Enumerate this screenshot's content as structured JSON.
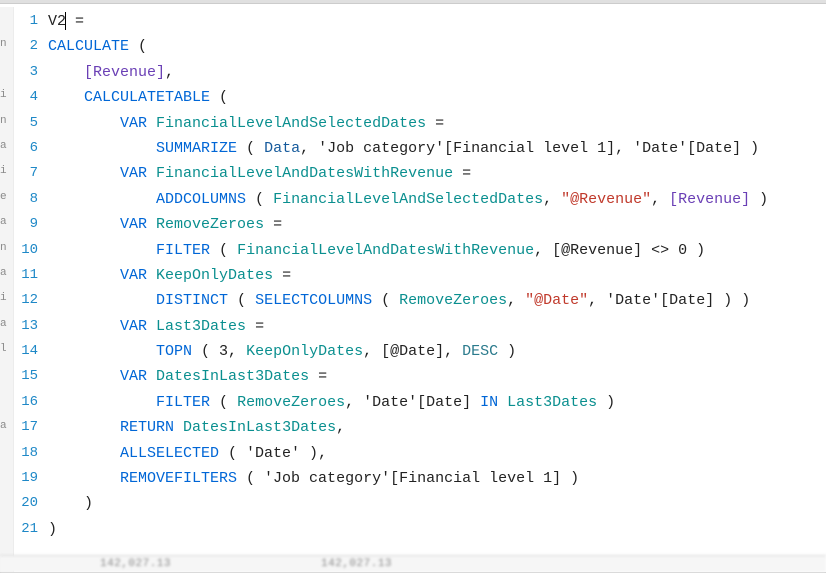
{
  "editor": {
    "leftEdgeChars": [
      "",
      "n",
      "",
      "i",
      "n",
      "a",
      "i",
      "e",
      "a",
      "n",
      "a",
      "i",
      "a",
      "l",
      "",
      "",
      "a",
      "",
      "",
      "",
      "",
      ""
    ],
    "lines": [
      {
        "num": 1,
        "indent": 0,
        "tokens": [
          {
            "t": "V2",
            "c": "op"
          },
          {
            "t": "|",
            "c": "cursor"
          },
          {
            "t": " =",
            "c": "op"
          }
        ]
      },
      {
        "num": 2,
        "indent": 0,
        "tokens": [
          {
            "t": "CALCULATE",
            "c": "kw"
          },
          {
            "t": " (",
            "c": "op"
          }
        ]
      },
      {
        "num": 3,
        "indent": 4,
        "tokens": [
          {
            "t": "[Revenue]",
            "c": "measure"
          },
          {
            "t": ",",
            "c": "op"
          }
        ]
      },
      {
        "num": 4,
        "indent": 4,
        "tokens": [
          {
            "t": "CALCULATETABLE",
            "c": "fn"
          },
          {
            "t": " (",
            "c": "op"
          }
        ]
      },
      {
        "num": 5,
        "indent": 8,
        "tokens": [
          {
            "t": "VAR",
            "c": "kw"
          },
          {
            "t": " ",
            "c": "op"
          },
          {
            "t": "FinancialLevelAndSelectedDates",
            "c": "varname"
          },
          {
            "t": " =",
            "c": "op"
          }
        ]
      },
      {
        "num": 6,
        "indent": 12,
        "tokens": [
          {
            "t": "SUMMARIZE",
            "c": "fn"
          },
          {
            "t": " ( ",
            "c": "op"
          },
          {
            "t": "Data",
            "c": "tbl"
          },
          {
            "t": ", 'Job category'[Financial level 1], 'Date'[Date] )",
            "c": "op"
          }
        ]
      },
      {
        "num": 7,
        "indent": 8,
        "tokens": [
          {
            "t": "VAR",
            "c": "kw"
          },
          {
            "t": " ",
            "c": "op"
          },
          {
            "t": "FinancialLevelAndDatesWithRevenue",
            "c": "varname"
          },
          {
            "t": " =",
            "c": "op"
          }
        ]
      },
      {
        "num": 8,
        "indent": 12,
        "tokens": [
          {
            "t": "ADDCOLUMNS",
            "c": "fn"
          },
          {
            "t": " ( ",
            "c": "op"
          },
          {
            "t": "FinancialLevelAndSelectedDates",
            "c": "varname"
          },
          {
            "t": ", ",
            "c": "op"
          },
          {
            "t": "\"@Revenue\"",
            "c": "str"
          },
          {
            "t": ", ",
            "c": "op"
          },
          {
            "t": "[Revenue]",
            "c": "measure"
          },
          {
            "t": " )",
            "c": "op"
          }
        ]
      },
      {
        "num": 9,
        "indent": 8,
        "tokens": [
          {
            "t": "VAR",
            "c": "kw"
          },
          {
            "t": " ",
            "c": "op"
          },
          {
            "t": "RemoveZeroes",
            "c": "varname"
          },
          {
            "t": " =",
            "c": "op"
          }
        ]
      },
      {
        "num": 10,
        "indent": 12,
        "tokens": [
          {
            "t": "FILTER",
            "c": "fn"
          },
          {
            "t": " ( ",
            "c": "op"
          },
          {
            "t": "FinancialLevelAndDatesWithRevenue",
            "c": "varname"
          },
          {
            "t": ", [@Revenue] <> 0 )",
            "c": "op"
          }
        ]
      },
      {
        "num": 11,
        "indent": 8,
        "tokens": [
          {
            "t": "VAR",
            "c": "kw"
          },
          {
            "t": " ",
            "c": "op"
          },
          {
            "t": "KeepOnlyDates",
            "c": "varname"
          },
          {
            "t": " =",
            "c": "op"
          }
        ]
      },
      {
        "num": 12,
        "indent": 12,
        "tokens": [
          {
            "t": "DISTINCT",
            "c": "fn"
          },
          {
            "t": " ( ",
            "c": "op"
          },
          {
            "t": "SELECTCOLUMNS",
            "c": "fn"
          },
          {
            "t": " ( ",
            "c": "op"
          },
          {
            "t": "RemoveZeroes",
            "c": "varname"
          },
          {
            "t": ", ",
            "c": "op"
          },
          {
            "t": "\"@Date\"",
            "c": "str"
          },
          {
            "t": ", 'Date'[Date] ) )",
            "c": "op"
          }
        ]
      },
      {
        "num": 13,
        "indent": 8,
        "tokens": [
          {
            "t": "VAR",
            "c": "kw"
          },
          {
            "t": " ",
            "c": "op"
          },
          {
            "t": "Last3Dates",
            "c": "varname"
          },
          {
            "t": " =",
            "c": "op"
          }
        ]
      },
      {
        "num": 14,
        "indent": 12,
        "tokens": [
          {
            "t": "TOPN",
            "c": "fn"
          },
          {
            "t": " ( 3, ",
            "c": "op"
          },
          {
            "t": "KeepOnlyDates",
            "c": "varname"
          },
          {
            "t": ", [@Date], ",
            "c": "op"
          },
          {
            "t": "DESC",
            "c": "desc"
          },
          {
            "t": " )",
            "c": "op"
          }
        ]
      },
      {
        "num": 15,
        "indent": 8,
        "tokens": [
          {
            "t": "VAR",
            "c": "kw"
          },
          {
            "t": " ",
            "c": "op"
          },
          {
            "t": "DatesInLast3Dates",
            "c": "varname"
          },
          {
            "t": " =",
            "c": "op"
          }
        ]
      },
      {
        "num": 16,
        "indent": 12,
        "tokens": [
          {
            "t": "FILTER",
            "c": "fn"
          },
          {
            "t": " ( ",
            "c": "op"
          },
          {
            "t": "RemoveZeroes",
            "c": "varname"
          },
          {
            "t": ", 'Date'[Date] ",
            "c": "op"
          },
          {
            "t": "IN",
            "c": "kw"
          },
          {
            "t": " ",
            "c": "op"
          },
          {
            "t": "Last3Dates",
            "c": "varname"
          },
          {
            "t": " )",
            "c": "op"
          }
        ]
      },
      {
        "num": 17,
        "indent": 8,
        "tokens": [
          {
            "t": "RETURN",
            "c": "kw"
          },
          {
            "t": " ",
            "c": "op"
          },
          {
            "t": "DatesInLast3Dates",
            "c": "varname"
          },
          {
            "t": ",",
            "c": "op"
          }
        ]
      },
      {
        "num": 18,
        "indent": 8,
        "tokens": [
          {
            "t": "ALLSELECTED",
            "c": "fn"
          },
          {
            "t": " ( 'Date' ),",
            "c": "op"
          }
        ]
      },
      {
        "num": 19,
        "indent": 8,
        "tokens": [
          {
            "t": "REMOVEFILTERS",
            "c": "fn"
          },
          {
            "t": " ( 'Job category'[Financial level 1] )",
            "c": "op"
          }
        ]
      },
      {
        "num": 20,
        "indent": 4,
        "tokens": [
          {
            "t": ")",
            "c": "op"
          }
        ]
      },
      {
        "num": 21,
        "indent": 0,
        "tokens": [
          {
            "t": ")",
            "c": "op"
          }
        ]
      }
    ]
  },
  "footer": {
    "a": "142,027.13",
    "b": "142,027.13"
  }
}
